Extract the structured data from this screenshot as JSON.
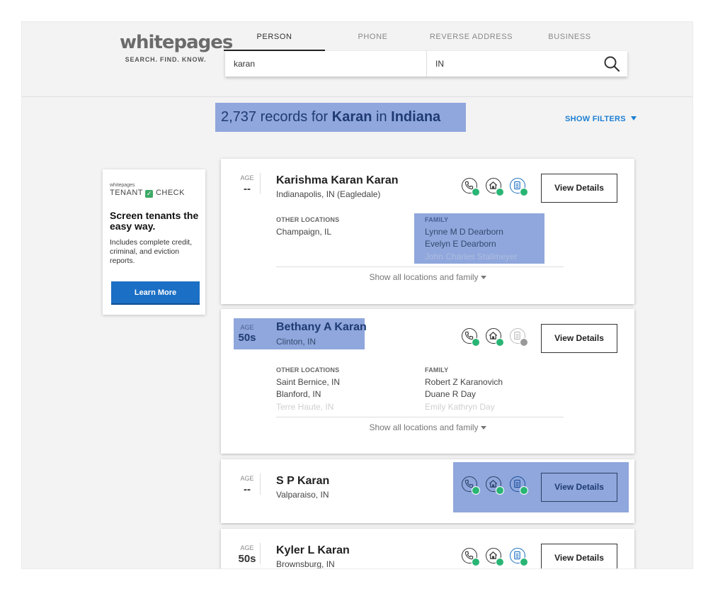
{
  "brand": {
    "logo_text": "whitepages",
    "tagline": "SEARCH. FIND. KNOW."
  },
  "tabs": [
    {
      "label": "PERSON",
      "active": true
    },
    {
      "label": "PHONE",
      "active": false
    },
    {
      "label": "REVERSE ADDRESS",
      "active": false
    },
    {
      "label": "BUSINESS",
      "active": false
    }
  ],
  "search": {
    "name_value": "karan",
    "location_value": "IN",
    "button_icon": "search-icon"
  },
  "results": {
    "count": "2,737",
    "mid1": " records for ",
    "name": "Karan",
    "mid2": " in ",
    "location": "Indiana"
  },
  "filters_label": "SHOW FILTERS",
  "ad": {
    "small_brand": "whitepages",
    "brand_left": "TENANT",
    "brand_right": "CHECK",
    "headline": "Screen tenants the easy way.",
    "body": "Includes complete credit, criminal, and eviction reports.",
    "button": "Learn More"
  },
  "labels": {
    "age": "AGE",
    "other_locations": "OTHER LOCATIONS",
    "family": "FAMILY",
    "show_all": "Show all locations and family",
    "view_details": "View Details"
  },
  "cards": [
    {
      "age": "--",
      "name": "Karishma Karan Karan",
      "location": "Indianapolis, IN (Eagledale)",
      "other_locations": [
        "Champaign, IL"
      ],
      "family": [
        "Lynne M D Dearborn",
        "Evelyn E Dearborn",
        "John Charles Stallmeyer"
      ],
      "icons": {
        "phone": "available",
        "address": "available",
        "records": "available"
      }
    },
    {
      "age": "50s",
      "name": "Bethany A Karan",
      "location": "Clinton, IN",
      "other_locations": [
        "Saint Bernice, IN",
        "Blanford, IN",
        "Terre Haute, IN"
      ],
      "family": [
        "Robert Z Karanovich",
        "Duane R Day",
        "Emily Kathryn Day"
      ],
      "icons": {
        "phone": "available",
        "address": "available",
        "records": "unavailable"
      }
    },
    {
      "age": "--",
      "name": "S P Karan",
      "location": "Valparaiso, IN",
      "icons": {
        "phone": "available",
        "address": "available",
        "records": "available"
      }
    },
    {
      "age": "50s",
      "name": "Kyler L Karan",
      "location": "Brownsburg, IN",
      "icons": {
        "phone": "available",
        "address": "available",
        "records": "available"
      }
    }
  ],
  "colors": {
    "accent_blue": "#1c7fd3",
    "highlight": "#8fa7dc",
    "available_green": "#29b574"
  }
}
